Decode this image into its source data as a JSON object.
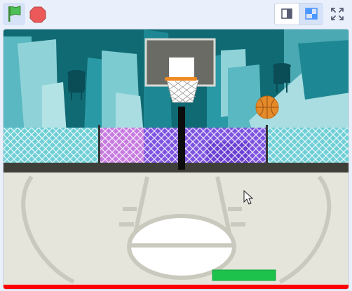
{
  "toolbar": {
    "green_flag_icon": "green-flag-icon",
    "stop_icon": "stop-sign-icon",
    "small_stage_icon": "small-stage-mode-icon",
    "large_stage_icon": "large-stage-mode-icon",
    "fullscreen_icon": "fullscreen-icon"
  },
  "colors": {
    "accent": "#4c97ff",
    "flag_green": "#45993d",
    "stop_red": "#ec5959",
    "sky_teal": "#0f6a73",
    "court_floor": "#e5e5dc",
    "paddle_green": "#1cc24b",
    "floor_line_red": "#ff0000",
    "basketball_orange": "#e58a2a"
  }
}
